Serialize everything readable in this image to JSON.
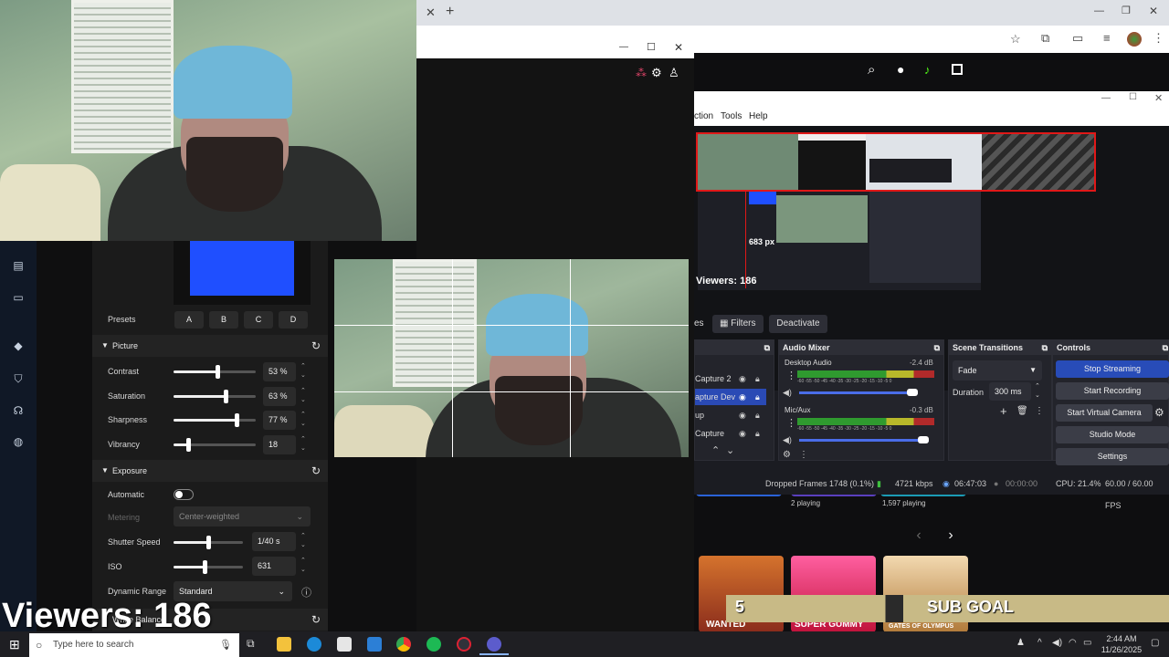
{
  "browser": {
    "new_tab": "+",
    "close_tab": "✕"
  },
  "camera_window": {
    "controls": [
      "—",
      "☐",
      "✕"
    ]
  },
  "settings": {
    "presets_label": "Presets",
    "presets": [
      "A",
      "B",
      "C",
      "D"
    ],
    "picture": {
      "title": "Picture",
      "rows": [
        {
          "label": "Contrast",
          "value": "53 %",
          "level": 0.53
        },
        {
          "label": "Saturation",
          "value": "63 %",
          "level": 0.63
        },
        {
          "label": "Sharpness",
          "value": "77 %",
          "level": 0.77
        },
        {
          "label": "Vibrancy",
          "value": "18",
          "level": 0.18
        }
      ]
    },
    "exposure": {
      "title": "Exposure",
      "automatic_label": "Automatic",
      "metering_label": "Metering",
      "metering_value": "Center-weighted",
      "shutter_label": "Shutter Speed",
      "shutter_value": "1/40 s",
      "shutter_level": 0.5,
      "iso_label": "ISO",
      "iso_value": "631",
      "iso_level": 0.45,
      "dynamic_label": "Dynamic Range",
      "dynamic_value": "Standard"
    },
    "white_balance": {
      "title": "White Balance"
    },
    "accent_color": "#1f4fff"
  },
  "obs": {
    "menu": [
      "ction",
      "Tools",
      "Help"
    ],
    "preview_measure": "683 px",
    "preview_viewers": "Viewers: 186",
    "filters_label": "Filters",
    "deactivate_label": "Deactivate",
    "es_label": "es",
    "sources": [
      "Capture 2",
      "apture Dev",
      "up",
      "Capture"
    ],
    "audio_mixer": {
      "title": "Audio Mixer",
      "channels": [
        {
          "name": "Desktop Audio",
          "db": "-2.4 dB"
        },
        {
          "name": "Mic/Aux",
          "db": "-0.3 dB"
        }
      ],
      "scale": "-60 -55 -50 -45 -40 -35 -30 -25 -20 -15 -10 -5 0"
    },
    "scene_transitions": {
      "title": "Scene Transitions",
      "transition": "Fade",
      "duration_label": "Duration",
      "duration_value": "300 ms"
    },
    "controls": {
      "title": "Controls",
      "buttons": [
        "Stop Streaming",
        "Start Recording",
        "Start Virtual Camera",
        "Studio Mode",
        "Settings"
      ]
    },
    "status": {
      "dropped": "Dropped Frames 1748 (0.1%)",
      "kbps": "4721 kbps",
      "stream_time": "06:47:03",
      "rec_time": "00:00:00",
      "cpu": "CPU: 21.4%",
      "fps": "60.00 / 60.00 FPS"
    }
  },
  "kick": {
    "playing_a": "2 playing",
    "playing_b": "1,597 playing",
    "prev": "‹",
    "next": "›",
    "games": [
      {
        "title": "WANTED"
      },
      {
        "title": "SUPER GUMMY"
      },
      {
        "title": "GATES OF OLYMPUS"
      }
    ]
  },
  "overlay": {
    "viewers": "Viewers: 186",
    "sub_count": "5",
    "sub_goal": "SUB GOAL"
  },
  "taskbar": {
    "search_placeholder": "Type here to search",
    "time": "2:44 AM",
    "date": "11/26/2025"
  }
}
